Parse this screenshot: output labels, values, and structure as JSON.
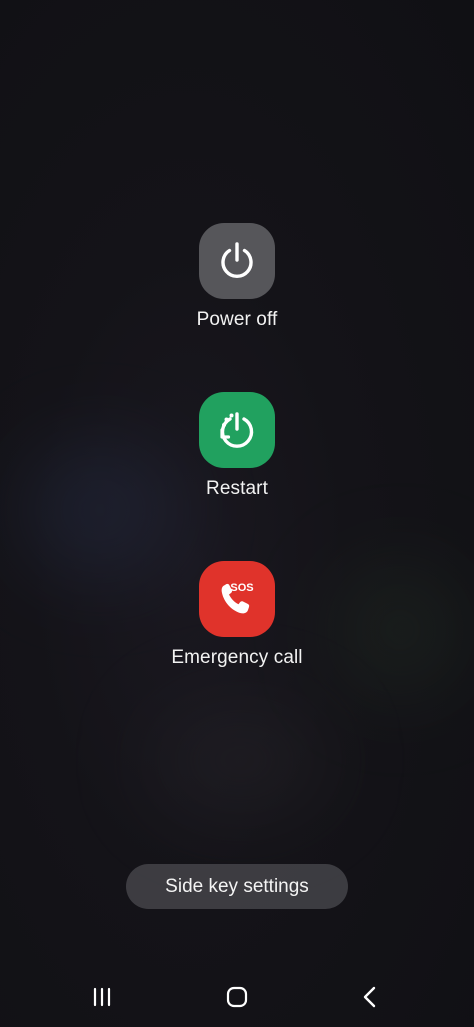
{
  "actions": [
    {
      "label": "Power off",
      "color": "#56565a",
      "icon": "power-icon"
    },
    {
      "label": "Restart",
      "color": "#21a15f",
      "icon": "restart-icon"
    },
    {
      "label": "Emergency call",
      "color": "#e0332b",
      "icon": "sos-phone-icon",
      "badge": "SOS"
    }
  ],
  "side_key": {
    "label": "Side key settings"
  },
  "nav": {
    "recents": "recent-apps-icon",
    "home": "home-icon",
    "back": "back-icon"
  }
}
